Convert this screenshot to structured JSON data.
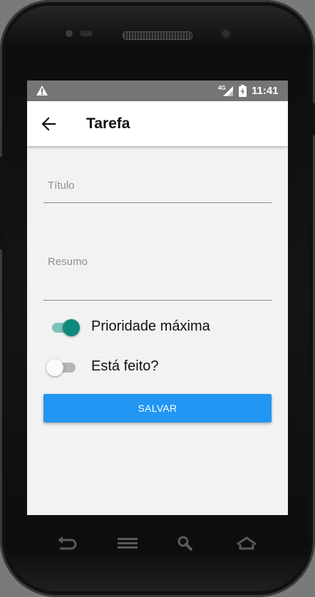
{
  "status_bar": {
    "network_type": "4G",
    "time": "11:41",
    "icons": [
      "warning-icon",
      "signal-icon",
      "battery-charging-icon"
    ]
  },
  "app_bar": {
    "title": "Tarefa",
    "back_icon": "arrow-back-icon"
  },
  "form": {
    "title_field": {
      "placeholder": "Título",
      "value": ""
    },
    "summary_field": {
      "placeholder": "Resumo",
      "value": ""
    },
    "priority_switch": {
      "label": "Prioridade máxima",
      "checked": true
    },
    "done_switch": {
      "label": "Está feito?",
      "checked": false
    },
    "save_label": "SALVAR"
  },
  "nav_bar": {
    "icons": [
      "back-nav-icon",
      "menu-nav-icon",
      "search-nav-icon",
      "home-nav-icon"
    ]
  },
  "colors": {
    "accent": "#0e8a7b",
    "button": "#2196f3",
    "status_bar": "#757575",
    "background": "#f2f2f2"
  }
}
